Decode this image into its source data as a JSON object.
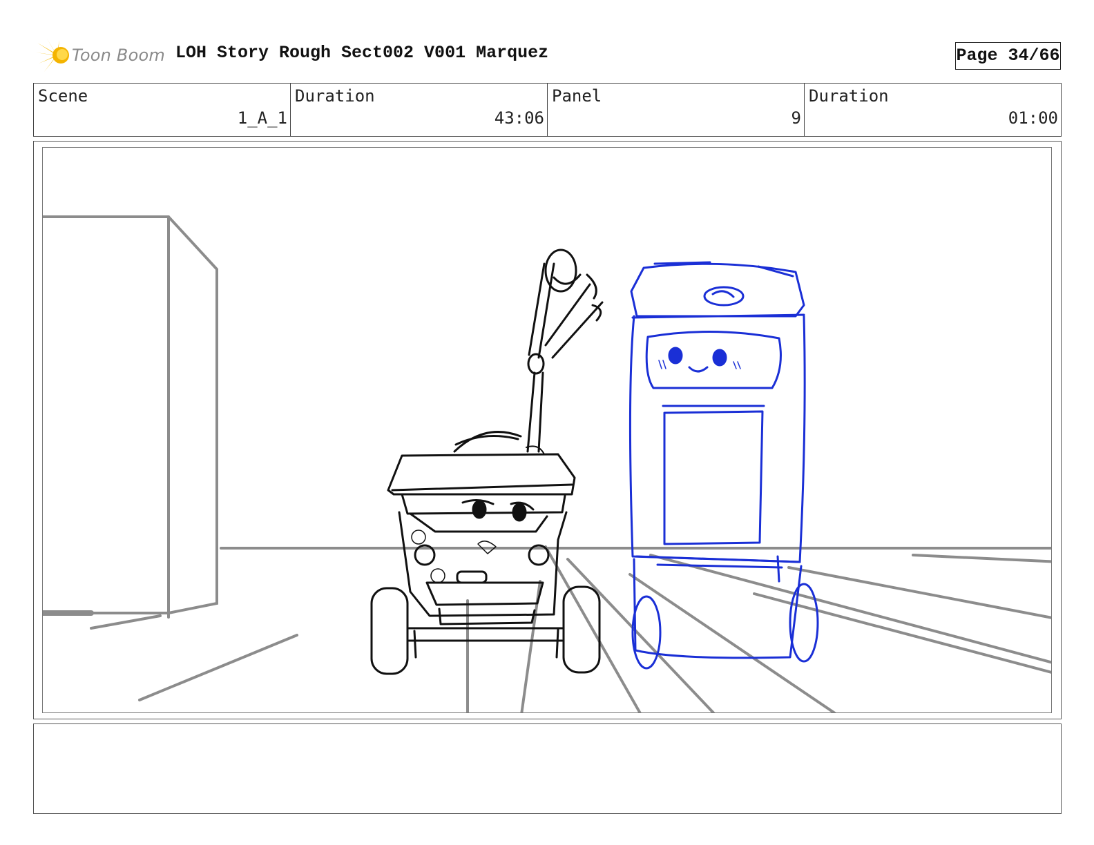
{
  "header": {
    "logo_text": "Toon Boom",
    "title": "LOH Story Rough Sect002 V001 Marquez",
    "page_label": "Page 34/66"
  },
  "info": {
    "scene_label": "Scene",
    "scene_value": "1_A_1",
    "duration_label": "Duration",
    "duration_value": "43:06",
    "panel_label": "Panel",
    "panel_value": "9",
    "panel_duration_label": "Duration",
    "panel_duration_value": "01:00"
  },
  "colors": {
    "sketch_black": "#111111",
    "sketch_blue": "#1a2fd6",
    "layout_grey": "#8c8c8c",
    "logo_yellow": "#f6c21a"
  },
  "notes": {
    "text": ""
  }
}
